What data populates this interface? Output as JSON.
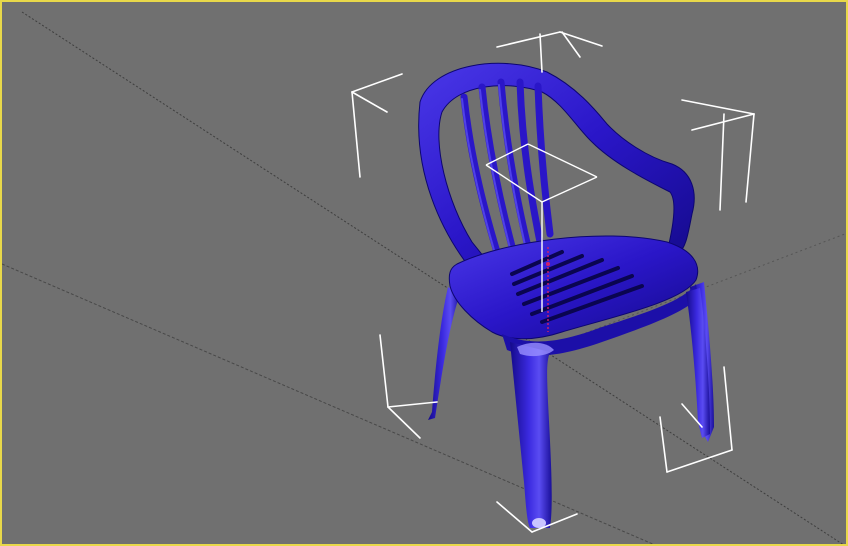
{
  "viewport": {
    "active": true,
    "active_border_color": "#e8d84a",
    "background_color": "#707070",
    "grid_line_color": "#3e3e3e"
  },
  "selected_object": {
    "shape": "plastic-monobloc-chair",
    "color": "#2a16c8",
    "highlight_color": "#6b5cf0",
    "shadow_color": "#0d0670",
    "selection_brackets_color": "#ffffff"
  },
  "gizmo": {
    "type": "transform-axis-tripod",
    "color": "#ffffff",
    "pivot_color": "#d0206a"
  }
}
